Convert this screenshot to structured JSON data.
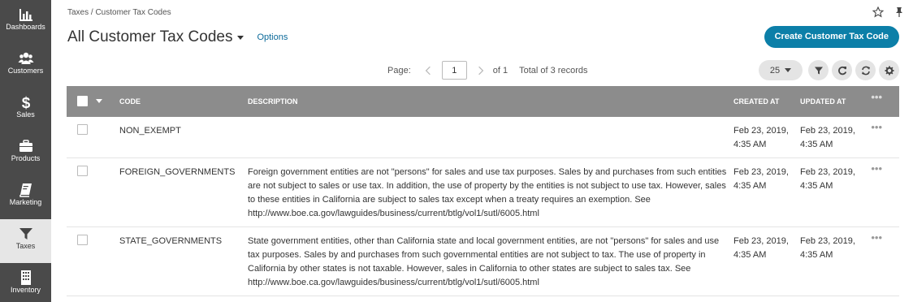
{
  "sidebar": {
    "items": [
      {
        "label": "Dashboards",
        "icon": "bar-chart-icon"
      },
      {
        "label": "Customers",
        "icon": "users-icon"
      },
      {
        "label": "Sales",
        "icon": "dollar-icon"
      },
      {
        "label": "Products",
        "icon": "briefcase-icon"
      },
      {
        "label": "Marketing",
        "icon": "book-icon"
      },
      {
        "label": "Taxes",
        "icon": "filter-icon"
      },
      {
        "label": "Inventory",
        "icon": "building-icon"
      }
    ]
  },
  "header": {
    "breadcrumb": "Taxes / Customer Tax Codes",
    "title": "All Customer Tax Codes",
    "options_label": "Options",
    "create_label": "Create Customer Tax Code"
  },
  "pager": {
    "page_label": "Page:",
    "current_page": "1",
    "of_label": "of 1",
    "total_label": "Total of 3 records",
    "per_page": "25"
  },
  "table": {
    "columns": {
      "code": "Code",
      "description": "Description",
      "created_at": "Created At",
      "updated_at": "Updated At"
    },
    "rows": [
      {
        "code": "NON_EXEMPT",
        "description": "",
        "created_at": "Feb 23, 2019, 4:35 AM",
        "updated_at": "Feb 23, 2019, 4:35 AM"
      },
      {
        "code": "FOREIGN_GOVERNMENTS",
        "description": "Foreign government entities are not \"persons\" for sales and use tax purposes. Sales by and purchases from such entities are not subject to sales or use tax. In addition, the use of property by the entities is not subject to use tax. However, sales to these entities in California are subject to sales tax except when a treaty requires an exemption. See http://www.boe.ca.gov/lawguides/business/current/btlg/vol1/sutl/6005.html",
        "created_at": "Feb 23, 2019, 4:35 AM",
        "updated_at": "Feb 23, 2019, 4:35 AM"
      },
      {
        "code": "STATE_GOVERNMENTS",
        "description": "State government entities, other than California state and local government entities, are not \"persons\" for sales and use tax purposes. Sales by and purchases from such governmental entities are not subject to tax. The use of property in California by other states is not taxable. However, sales in California to other states are subject to sales tax. See http://www.boe.ca.gov/lawguides/business/current/btlg/vol1/sutl/6005.html",
        "created_at": "Feb 23, 2019, 4:35 AM",
        "updated_at": "Feb 23, 2019, 4:35 AM"
      }
    ]
  },
  "colors": {
    "sidebar_bg": "#4a4a4a",
    "accent": "#0c7fa8",
    "table_header_bg": "#8c8c8c"
  }
}
